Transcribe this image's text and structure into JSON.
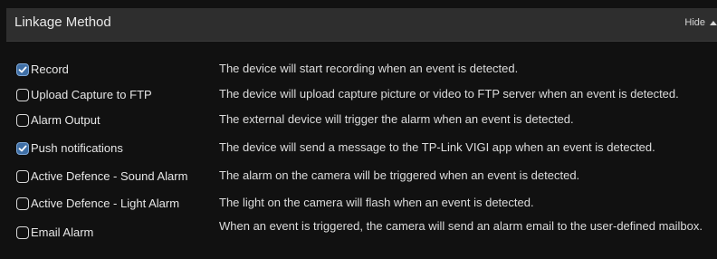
{
  "section": {
    "title": "Linkage Method",
    "toggle_label": "Hide"
  },
  "options": [
    {
      "label": "Record",
      "checked": true,
      "description": "The device will start recording when an event is detected."
    },
    {
      "label": "Upload Capture to FTP",
      "checked": false,
      "description": "The device will upload capture picture or video to FTP server when an event is detected."
    },
    {
      "label": "Alarm Output",
      "checked": false,
      "description": "The external device will trigger the alarm when an event is detected."
    },
    {
      "label": "Push notifications",
      "checked": true,
      "description": "The device will send a message to the TP-Link VIGI app when an event is detected."
    },
    {
      "label": "Active Defence - Sound Alarm",
      "checked": false,
      "description": "The alarm on the camera will be triggered when an event is detected."
    },
    {
      "label": "Active Defence - Light Alarm",
      "checked": false,
      "description": "The light on the camera will flash when an event is detected."
    },
    {
      "label": "Email Alarm",
      "checked": false,
      "description": "When an event is triggered, the camera will send an alarm email to the user-defined mailbox."
    }
  ],
  "colors": {
    "background": "#111111",
    "header_bg": "#2e2e2e",
    "checkbox_checked": "#3f6fa6"
  }
}
